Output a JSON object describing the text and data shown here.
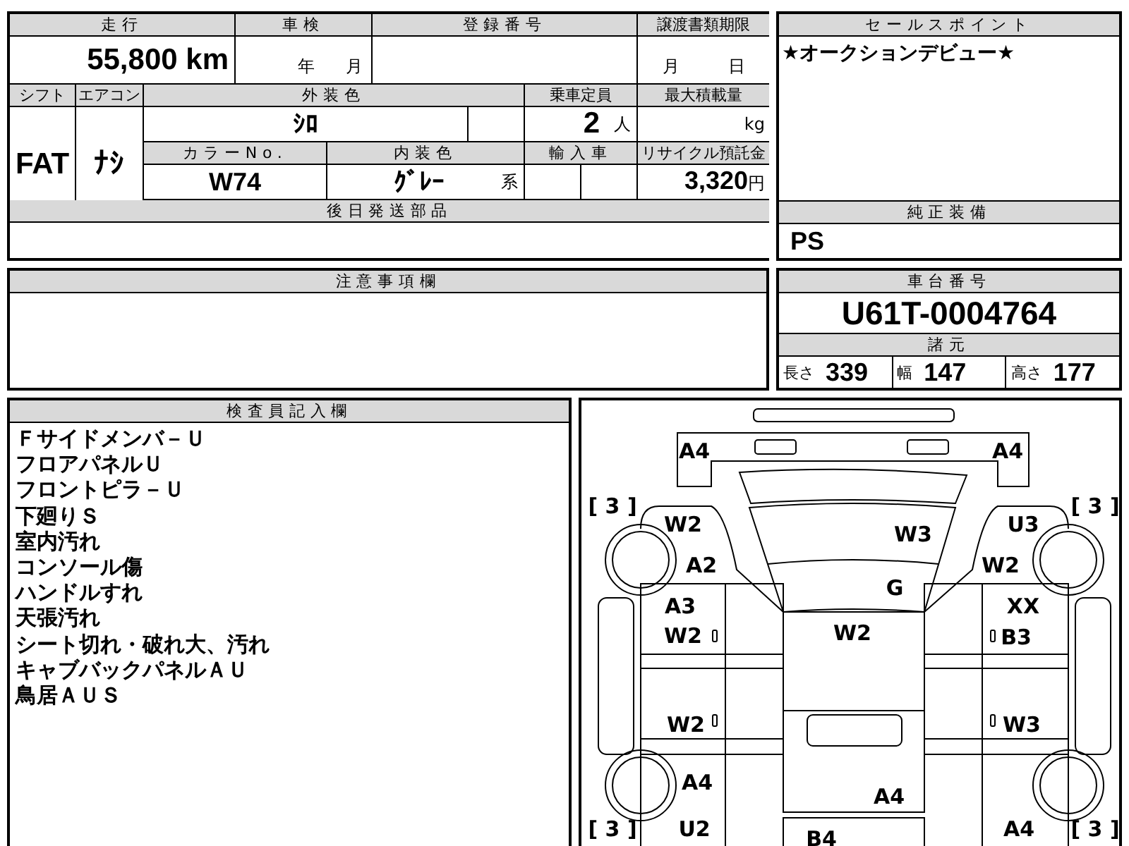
{
  "mileage": {
    "label": "走行",
    "value": "55,800 km"
  },
  "inspection": {
    "label": "車検",
    "year_unit": "年",
    "month_unit": "月"
  },
  "registration_number": {
    "label": "登録番号"
  },
  "transfer_deadline": {
    "label": "譲渡書類期限",
    "month_unit": "月",
    "day_unit": "日"
  },
  "shift": {
    "label": "シフト",
    "value": "FAT"
  },
  "air_conditioner": {
    "label": "エアコン",
    "value": "ﾅｼ"
  },
  "exterior_color": {
    "label": "外装色",
    "value": "ｼﾛ"
  },
  "capacity": {
    "label": "乗車定員",
    "value": "2",
    "unit": "人"
  },
  "max_load": {
    "label": "最大積載量",
    "unit": "kg"
  },
  "color_no": {
    "label": "カラーNo.",
    "value": "W74"
  },
  "interior_color": {
    "label": "内装色",
    "value": "ｸﾞﾚｰ",
    "suffix": "系"
  },
  "imported": {
    "label": "輸入車"
  },
  "recycling_deposit": {
    "label": "リサイクル預託金",
    "value": "3,320",
    "unit": "円"
  },
  "parts_to_ship_later": {
    "label": "後日発送部品"
  },
  "sales_point": {
    "label": "セールスポイント",
    "text": "★オークションデビュー★"
  },
  "genuine_equipment": {
    "label": "純正装備",
    "value": "PS"
  },
  "notes": {
    "label": "注意事項欄"
  },
  "chassis": {
    "label": "車台番号",
    "value": "U61T-0004764"
  },
  "specs": {
    "label": "諸元",
    "items": [
      {
        "label": "長さ",
        "value": "339"
      },
      {
        "label": "幅",
        "value": "147"
      },
      {
        "label": "高さ",
        "value": "177"
      }
    ]
  },
  "inspector_notes": {
    "label": "検査員記入欄",
    "lines": [
      "Ｆサイドメンバ－Ｕ",
      "フロアパネルＵ",
      "フロントピラ－Ｕ",
      "下廻りＳ",
      "室内汚れ",
      "コンソール傷",
      "ハンドルすれ",
      "天張汚れ",
      "シート切れ・破れ大、汚れ",
      "キャブバックパネルＡＵ",
      "鳥居ＡＵＳ"
    ]
  },
  "diagram": {
    "front_bumper_left": "A4",
    "front_bumper_right": "A4",
    "tire_front_left": "[ 3 ]",
    "tire_front_right": "[ 3 ]",
    "front_left_fender_upper": "W2",
    "hood": "W3",
    "front_right_fender_upper": "U3",
    "front_left_fender_lower": "A2",
    "front_right_fender_lower": "W2",
    "cowl": "G",
    "left_door_upper": "A3",
    "right_door_upper": "XX",
    "left_door_lower": "W2",
    "cab_roof": "W2",
    "right_door_lower": "B3",
    "left_sill": "W2",
    "right_sill": "W3",
    "rear_left_fender": "A4",
    "bed": "A4",
    "tire_rear_left": "[ 3 ]",
    "rear_left_panel": "U2",
    "tailgate": "B4",
    "rear_right_panel": "A4",
    "tire_rear_right": "[ 3 ]"
  }
}
